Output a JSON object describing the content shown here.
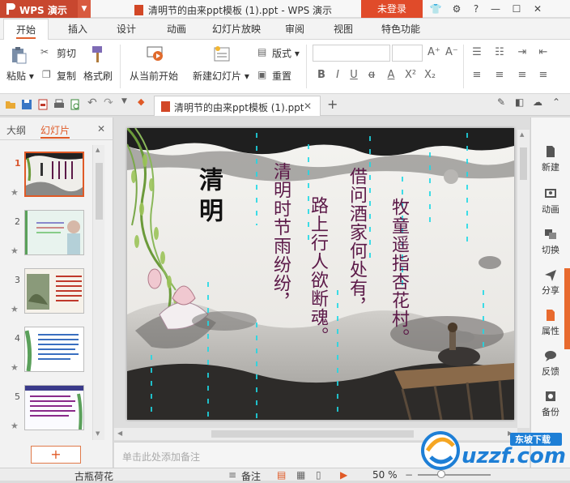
{
  "titlebar": {
    "app_name": "WPS 演示",
    "doc_title": "清明节的由来ppt模板 (1).ppt - WPS 演示",
    "login": "未登录"
  },
  "ribbon_tabs": [
    "开始",
    "插入",
    "设计",
    "动画",
    "幻灯片放映",
    "审阅",
    "视图",
    "特色功能"
  ],
  "ribbon": {
    "paste": "粘贴",
    "cut": "剪切",
    "copy": "复制",
    "format_painter": "格式刷",
    "from_current": "从当前开始",
    "new_slide": "新建幻灯片",
    "layout": "版式",
    "reset": "重置"
  },
  "doc_tab": {
    "title": "清明节的由来ppt模板 (1).ppt"
  },
  "left_panel": {
    "outline_tab": "大纲",
    "slides_tab": "幻灯片",
    "slide_numbers": [
      "1",
      "2",
      "3",
      "4",
      "5"
    ]
  },
  "slide": {
    "title": "清明",
    "poem_lines": [
      "清明时节雨纷纷，",
      "路上行人欲断魂。",
      "借问酒家何处有，",
      "牧童遥指杏花村。"
    ]
  },
  "notes_placeholder": "单击此处添加备注",
  "right_panel": [
    "新建",
    "动画",
    "切换",
    "分享",
    "属性",
    "反馈",
    "备份"
  ],
  "status": {
    "theme": "古瓶荷花",
    "notes_toggle": "备注",
    "zoom": "50 %"
  },
  "watermark": {
    "site": "uzzf.com",
    "tag": "东坡下载"
  },
  "colors": {
    "accent": "#e05a27",
    "wps_red": "#c8472f",
    "poem_text": "#5c1948"
  }
}
